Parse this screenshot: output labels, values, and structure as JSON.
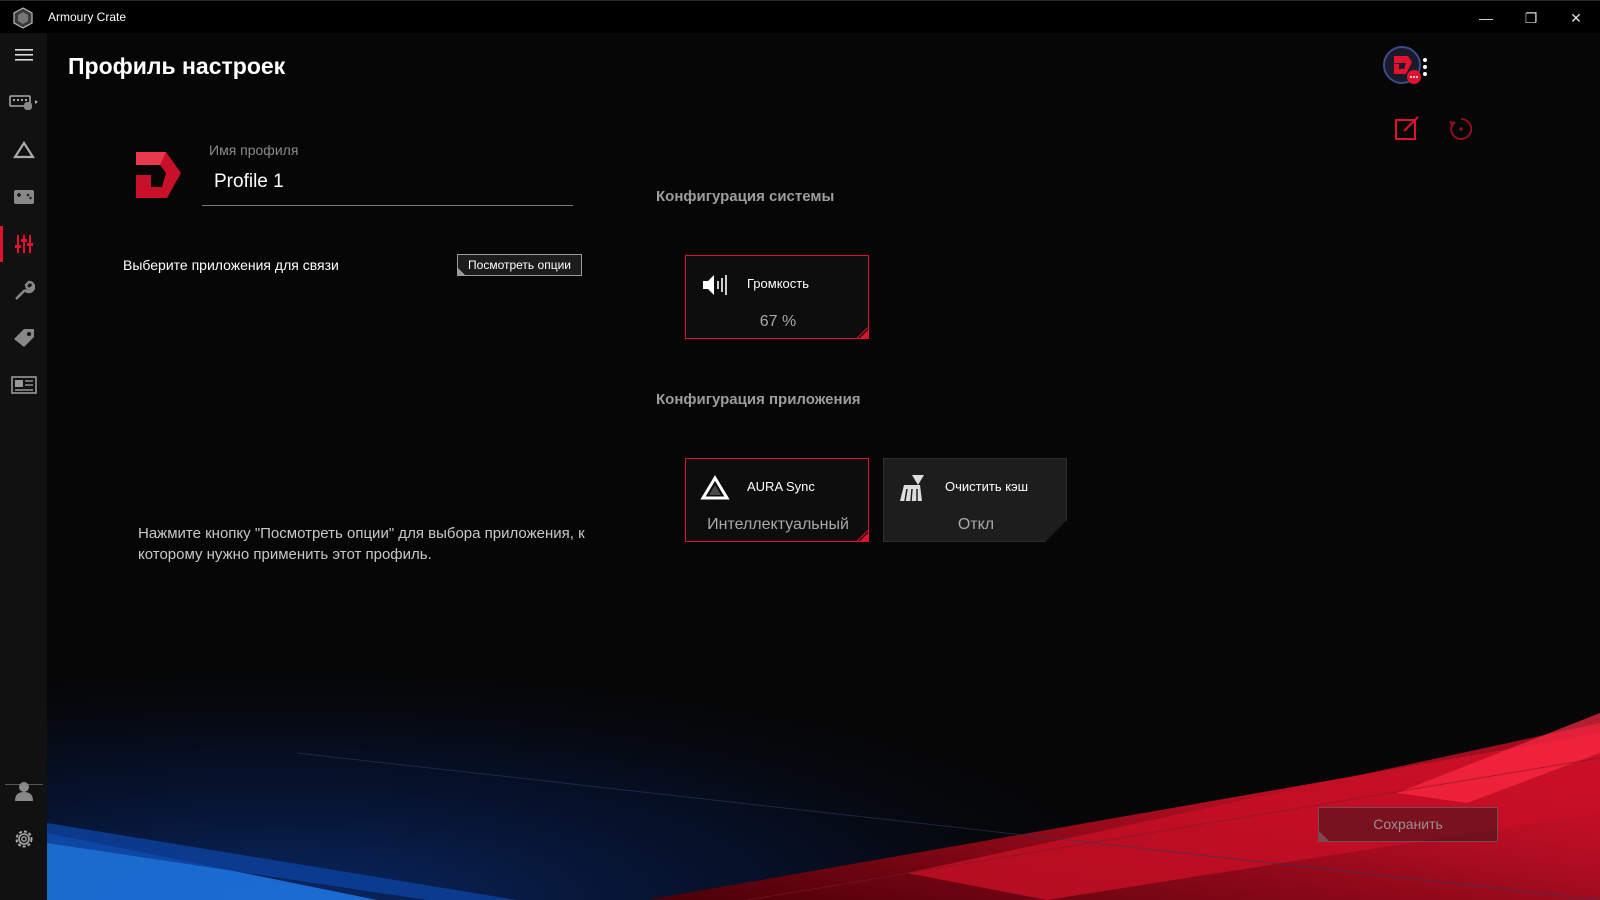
{
  "window": {
    "title": "Armoury Crate",
    "minimize": "—",
    "maximize": "❐",
    "close": "✕"
  },
  "page": {
    "title": "Профиль настроек"
  },
  "profile": {
    "name_label": "Имя профиля",
    "name_value": "Profile 1"
  },
  "apps_link": {
    "label": "Выберите приложения для связи",
    "button": "Посмотреть опции"
  },
  "hint": "Нажмите кнопку \"Посмотреть опции\" для выбора приложения, к которому нужно применить этот профиль.",
  "system_config": {
    "title": "Конфигурация системы",
    "tiles": [
      {
        "label": "Громкость",
        "value": "67 %",
        "icon": "speaker-icon"
      }
    ]
  },
  "app_config": {
    "title": "Конфигурация приложения",
    "tiles": [
      {
        "label": "AURA Sync",
        "value": "Интеллектуальный",
        "icon": "aura-icon"
      },
      {
        "label": "Очистить кэш",
        "value": "Откл",
        "icon": "broom-icon"
      }
    ]
  },
  "save_button": "Сохранить",
  "sidebar": {
    "items": [
      "menu-icon",
      "device-icon",
      "aura-icon",
      "gamevisual-icon",
      "scenario-profiles-icon",
      "tools-icon",
      "deals-icon",
      "news-icon",
      "user-icon",
      "settings-icon"
    ],
    "active": "scenario-profiles-icon"
  },
  "colors": {
    "accent": "#e1122d",
    "background": "#060606",
    "sidebar": "#111111"
  }
}
